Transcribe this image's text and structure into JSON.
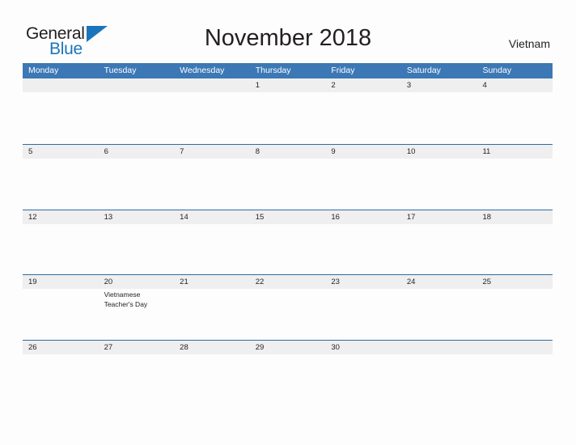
{
  "brand": {
    "name_part1": "General",
    "name_part2": "Blue",
    "triangle_color": "#1b75bb"
  },
  "header": {
    "title": "November 2018",
    "country": "Vietnam"
  },
  "colors": {
    "header_blue": "#3b78b5",
    "row_rule_blue": "#2e6da4",
    "date_band_gray": "#efefef",
    "text": "#231f20",
    "page_background": "#fdfdfd"
  },
  "calendar": {
    "weekdays": [
      "Monday",
      "Tuesday",
      "Wednesday",
      "Thursday",
      "Friday",
      "Saturday",
      "Sunday"
    ],
    "weeks": [
      {
        "days": [
          {
            "number": "",
            "event": ""
          },
          {
            "number": "",
            "event": ""
          },
          {
            "number": "",
            "event": ""
          },
          {
            "number": "1",
            "event": ""
          },
          {
            "number": "2",
            "event": ""
          },
          {
            "number": "3",
            "event": ""
          },
          {
            "number": "4",
            "event": ""
          }
        ]
      },
      {
        "days": [
          {
            "number": "5",
            "event": ""
          },
          {
            "number": "6",
            "event": ""
          },
          {
            "number": "7",
            "event": ""
          },
          {
            "number": "8",
            "event": ""
          },
          {
            "number": "9",
            "event": ""
          },
          {
            "number": "10",
            "event": ""
          },
          {
            "number": "11",
            "event": ""
          }
        ]
      },
      {
        "days": [
          {
            "number": "12",
            "event": ""
          },
          {
            "number": "13",
            "event": ""
          },
          {
            "number": "14",
            "event": ""
          },
          {
            "number": "15",
            "event": ""
          },
          {
            "number": "16",
            "event": ""
          },
          {
            "number": "17",
            "event": ""
          },
          {
            "number": "18",
            "event": ""
          }
        ]
      },
      {
        "days": [
          {
            "number": "19",
            "event": ""
          },
          {
            "number": "20",
            "event": "Vietnamese Teacher's Day"
          },
          {
            "number": "21",
            "event": ""
          },
          {
            "number": "22",
            "event": ""
          },
          {
            "number": "23",
            "event": ""
          },
          {
            "number": "24",
            "event": ""
          },
          {
            "number": "25",
            "event": ""
          }
        ]
      },
      {
        "days": [
          {
            "number": "26",
            "event": ""
          },
          {
            "number": "27",
            "event": ""
          },
          {
            "number": "28",
            "event": ""
          },
          {
            "number": "29",
            "event": ""
          },
          {
            "number": "30",
            "event": ""
          },
          {
            "number": "",
            "event": ""
          },
          {
            "number": "",
            "event": ""
          }
        ]
      }
    ]
  }
}
